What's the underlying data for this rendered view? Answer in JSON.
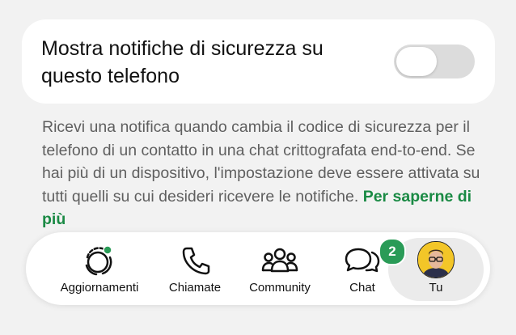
{
  "setting": {
    "label": "Mostra notifiche di sicurezza su questo telefono",
    "toggle_on": false
  },
  "description": {
    "text": "Ricevi una notifica quando cambia il codice di sicurezza per il telefono di un contatto in una chat crittografata end-to-end. Se hai più di un dispositivo, l'impostazione deve essere attivata su tutti quelli su cui desideri ricevere le notifiche.",
    "link": "Per saperne di più"
  },
  "tabbar": {
    "tabs": [
      {
        "label": "Aggiornamenti",
        "icon": "updates-icon"
      },
      {
        "label": "Chiamate",
        "icon": "phone-icon"
      },
      {
        "label": "Community",
        "icon": "community-icon"
      },
      {
        "label": "Chat",
        "icon": "chat-icon",
        "badge": "2"
      },
      {
        "label": "Tu",
        "icon": "avatar",
        "active": true
      }
    ]
  },
  "colors": {
    "accent_green": "#1a8a44",
    "badge_green": "#2a9b57",
    "toggle_off": "#dcdcdc"
  }
}
